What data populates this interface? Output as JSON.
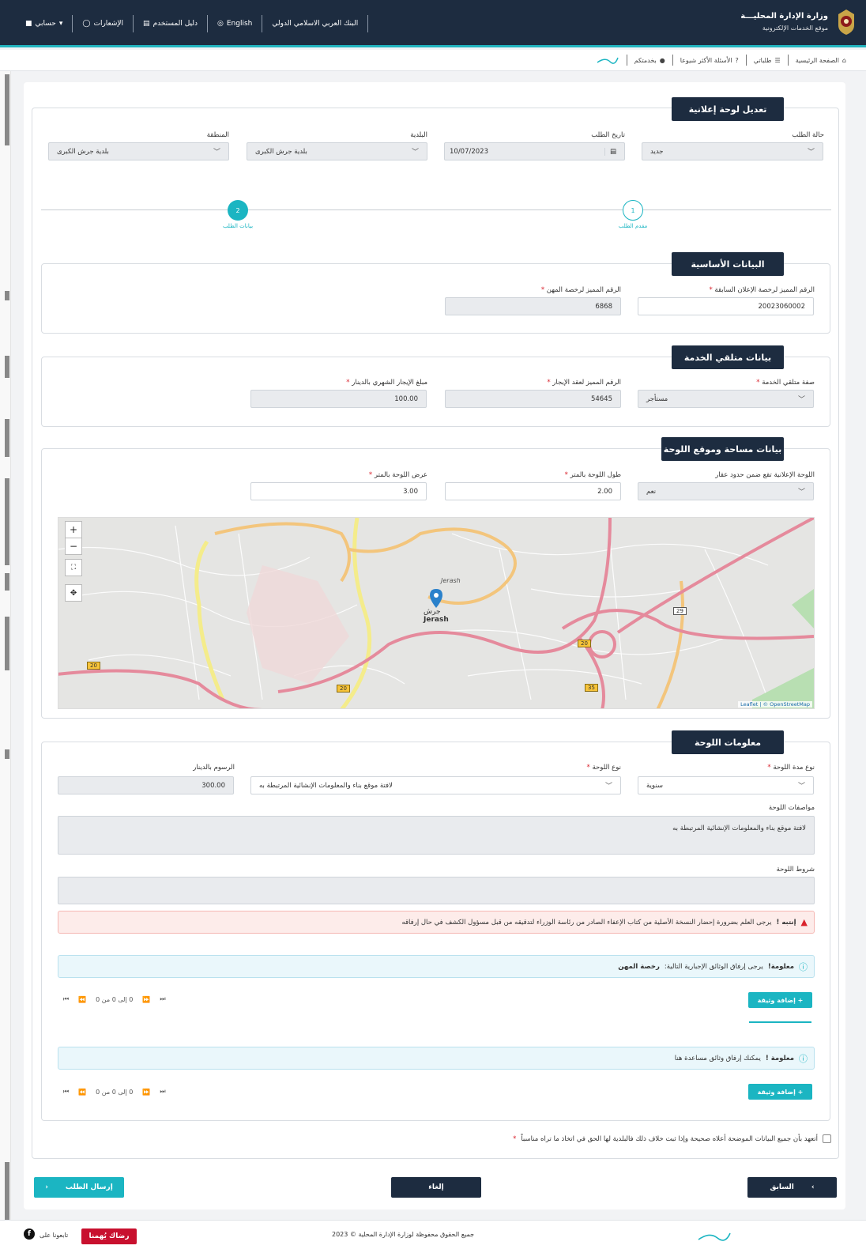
{
  "header": {
    "ministry_title": "وزارة الإدارة المحليـــة",
    "ministry_subtitle": "موقع الخدمات الإلكترونية",
    "bank": "البنك العربي الاسلامي الدولي",
    "language": "English",
    "user_guide": "دليل المستخدم",
    "notifications": "الإشعارات",
    "account": "حسابي"
  },
  "subnav": {
    "home": "الصفحة الرئيسية",
    "my_requests": "طلباتي",
    "faq": "الأسئلة الأكثر شيوعا",
    "at_service": "بخدمتكم"
  },
  "form": {
    "title": "تعديل لوحة إعلانية",
    "status_label": "حالة الطلب",
    "status_value": "جديد",
    "date_label": "تاريخ الطلب",
    "date_value": "10/07/2023",
    "municipality_label": "البلدية",
    "municipality_value": "بلدية جرش الكبرى",
    "region_label": "المنطقة",
    "region_value": "بلدية جرش الكبرى"
  },
  "steps": [
    {
      "num": "1",
      "label": "مقدم الطلب"
    },
    {
      "num": "2",
      "label": "بيانات الطلب"
    }
  ],
  "basic": {
    "title": "البيانات الأساسية",
    "prev_license_label": "الرقم المميز لرخصة الإعلان السابقة",
    "prev_license_value": "20023060002",
    "prof_license_label": "الرقم المميز لرخصة المهن",
    "prof_license_value": "6868"
  },
  "recipient": {
    "title": "بيانات متلقي الخدمة",
    "capacity_label": "صفة متلقي الخدمة",
    "capacity_value": "مستأجر",
    "lease_label": "الرقم المميز لعقد الإيجار",
    "lease_value": "54645",
    "rent_label": "مبلغ الإيجار الشهري بالدينار",
    "rent_value": "100.00"
  },
  "area": {
    "title": "بيانات مساحة وموقع اللوحة",
    "within_label": "اللوحة الإعلانية تقع ضمن حدود عقار",
    "within_value": "نعم",
    "length_label": "طول اللوحة بالمتر",
    "length_value": "2.00",
    "width_label": "عرض اللوحة بالمتر",
    "width_value": "3.00"
  },
  "map": {
    "zoom_in": "+",
    "zoom_out": "−",
    "city_ar": "جرش",
    "city_en": "Jerash",
    "city_en2": "Jerash",
    "road_20a": "20",
    "road_20b": "20",
    "road_20c": "20",
    "road_35": "35",
    "road_29": "29",
    "attribution": "Leaflet | © OpenStreetMap"
  },
  "board": {
    "title": "معلومات اللوحة",
    "duration_label": "نوع مدة اللوحة",
    "duration_value": "سنوية",
    "type_label": "نوع اللوحة",
    "type_value": "لافتة موقع بناء والمعلومات الإنشائية المرتبطة به",
    "fees_label": "الرسوم بالدينار",
    "fees_value": "300.00",
    "specs_label": "مواصفات اللوحة",
    "specs_value": "لافتة موقع بناء والمعلومات الإنشائية المرتبطة به",
    "terms_label": "شروط اللوحة"
  },
  "alerts": {
    "warn_strong": "إنتبه !",
    "warn_text": "يرجى العلم بضرورة إحضار النسخة الأصلية من كتاب الإعفاء الصادر من رئاسة الوزراء لتدقيقه من قبل مسؤول الكشف في حال إرفاقه",
    "info1_strong": "معلومة!",
    "info1_text": "يرجى إرفاق الوثائق الإجبارية التالية:",
    "info1_doc": "رخصة المهن",
    "info2_strong": "معلومة !",
    "info2_text": "يمكنك إرفاق وثائق مساعدة هنا"
  },
  "docs": {
    "add_label": "+ إضافة وثيقة",
    "pager_text": "0 إلى 0 من 0"
  },
  "pledge": "أتعهد بأن جميع البيانات الموضحة أعلاه صحيحة وإذا ثبت خلاف ذلك فالبلدية لها الحق في اتخاذ ما تراه مناسباً",
  "buttons": {
    "previous": "السابق",
    "cancel": "إلغاء",
    "submit": "إرسال الطلب"
  },
  "footer": {
    "copyright": "جميع الحقوق محفوظة لوزارة الإدارة المحلية © 2023",
    "satisfaction": "رضاك يُهمنا",
    "follow": "تابعونا على"
  },
  "colors": {
    "navy": "#1d2c40",
    "teal": "#1bb5c2",
    "red": "#c8102e"
  }
}
